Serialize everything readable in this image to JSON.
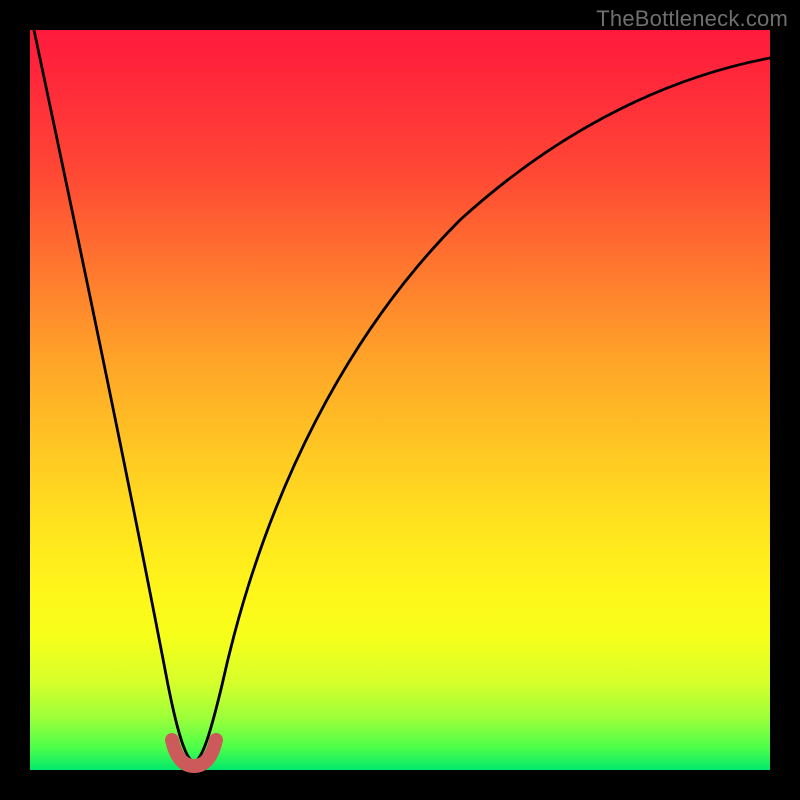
{
  "watermark": "TheBottleneck.com",
  "colors": {
    "gradient_top": "#ff1a3c",
    "gradient_bottom": "#00e86b",
    "curve": "#000000",
    "blob": "#cc5a5a",
    "frame": "#000000"
  },
  "chart_data": {
    "type": "line",
    "title": "",
    "xlabel": "",
    "ylabel": "",
    "xlim": [
      0,
      100
    ],
    "ylim": [
      0,
      100
    ],
    "grid": false,
    "legend": false,
    "series": [
      {
        "name": "bottleneck-curve",
        "x": [
          0,
          5,
          10,
          15,
          18,
          20,
          22,
          24,
          26,
          30,
          35,
          40,
          50,
          60,
          70,
          80,
          90,
          100
        ],
        "y": [
          100,
          76,
          52,
          28,
          10,
          2,
          0,
          2,
          10,
          28,
          44,
          55,
          68,
          76,
          82,
          86,
          89,
          91
        ]
      }
    ],
    "annotations": [
      {
        "name": "optimal-blob",
        "x_range": [
          19,
          25
        ],
        "y_range": [
          0,
          3
        ]
      }
    ]
  }
}
